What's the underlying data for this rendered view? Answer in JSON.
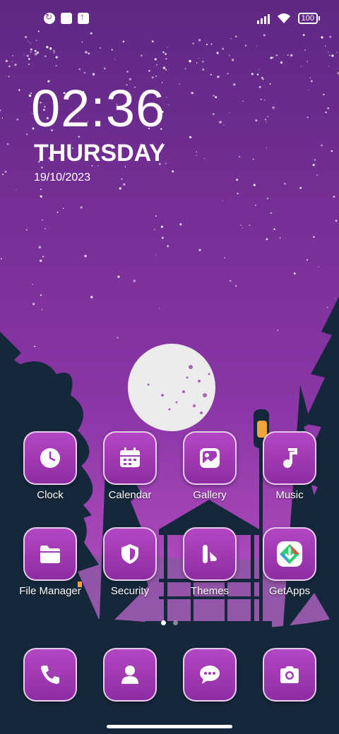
{
  "status_bar": {
    "battery": "100",
    "left_icons": [
      "data-saver-icon",
      "notification-icon",
      "upload-icon"
    ],
    "right_icons": [
      "signal-icon",
      "wifi-icon",
      "battery-icon"
    ]
  },
  "clock": {
    "time": "02:36",
    "day": "THURSDAY",
    "date": "19/10/2023"
  },
  "apps": {
    "row1": [
      {
        "label": "Clock",
        "icon": "clock-icon"
      },
      {
        "label": "Calendar",
        "icon": "calendar-icon"
      },
      {
        "label": "Gallery",
        "icon": "gallery-icon"
      },
      {
        "label": "Music",
        "icon": "music-icon"
      }
    ],
    "row2": [
      {
        "label": "File Manager",
        "icon": "folder-icon"
      },
      {
        "label": "Security",
        "icon": "shield-icon"
      },
      {
        "label": "Themes",
        "icon": "themes-icon"
      },
      {
        "label": "GetApps",
        "icon": "getapps-icon"
      }
    ]
  },
  "dock": [
    {
      "icon": "phone-icon"
    },
    {
      "icon": "contacts-icon"
    },
    {
      "icon": "messages-icon"
    },
    {
      "icon": "camera-icon"
    }
  ],
  "pager": {
    "pages": 2,
    "active": 1
  },
  "colors": {
    "sky_top": "#6a2a8c",
    "sky_bottom": "#b14bbf",
    "tile": "#a23bb6",
    "silhouette": "#14283a"
  }
}
